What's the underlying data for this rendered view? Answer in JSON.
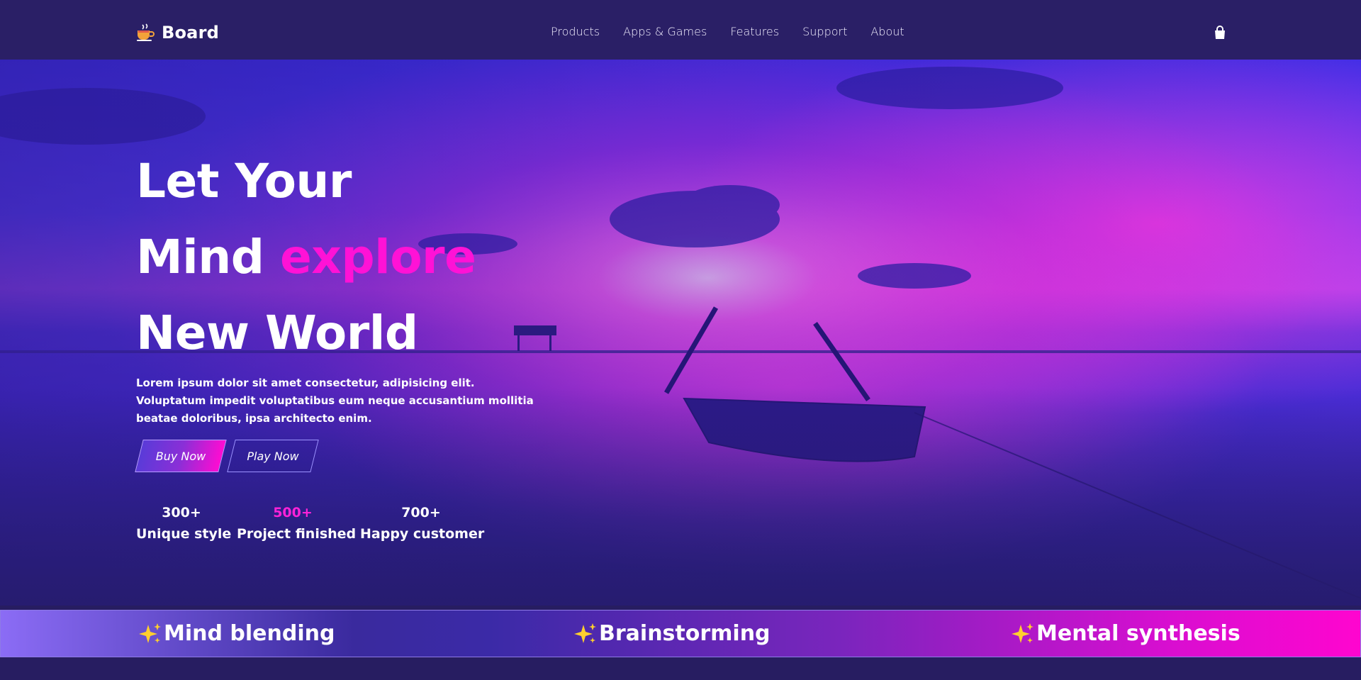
{
  "navbar": {
    "brand": {
      "name": "Board",
      "icon": "coffee-cup-icon"
    },
    "links": [
      {
        "label": "Products"
      },
      {
        "label": "Apps & Games"
      },
      {
        "label": "Features"
      },
      {
        "label": "Support"
      },
      {
        "label": "About"
      }
    ],
    "cart_icon": "shopping-bag-icon"
  },
  "hero": {
    "headline": {
      "line1": "Let Your",
      "line2_prefix": "Mind",
      "line2_accent": "explore",
      "line3": "New World"
    },
    "lead": "Lorem ipsum dolor sit amet consectetur, adipisicing elit. Voluptatum impedit voluptatibus eum neque accusantium mollitia beatae doloribus, ipsa architecto enim.",
    "buttons": {
      "buy": "Buy Now",
      "play": "Play Now"
    },
    "stats": [
      {
        "value": "300+",
        "label": "Unique style"
      },
      {
        "value": "500+",
        "label": "Project finished"
      },
      {
        "value": "700+",
        "label": "Happy customer"
      }
    ],
    "background": "sunset-lake-boat-image"
  },
  "banner": {
    "items": [
      {
        "label": "Mind blending",
        "icon": "sparkles-icon"
      },
      {
        "label": "Brainstorming",
        "icon": "sparkles-icon"
      },
      {
        "label": "Mental synthesis",
        "icon": "sparkles-icon"
      }
    ]
  },
  "colors": {
    "nav_bg": "#2a1f66",
    "page_bg": "#271d61",
    "accent_pink": "#ff12d6",
    "text": "#ffffff"
  }
}
